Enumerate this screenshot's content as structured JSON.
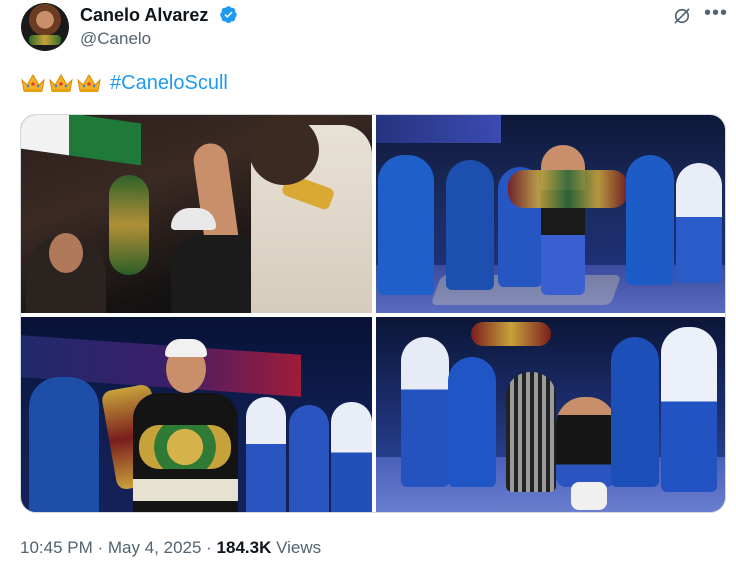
{
  "author": {
    "display_name": "Canelo Alvarez",
    "handle": "@Canelo",
    "verified": true,
    "avatar_icon": "profile-photo"
  },
  "actions": {
    "grok_icon": "grok-icon",
    "more_label": "•••"
  },
  "tweet": {
    "emojis": [
      "crown",
      "crown",
      "crown"
    ],
    "hashtag": "#CaneloScull"
  },
  "media": {
    "photo_count": 4
  },
  "meta": {
    "time": "10:45 PM",
    "sep1": " · ",
    "date": "May 4, 2025",
    "sep2": " · ",
    "views_count": "184.3K",
    "views_label": " Views"
  },
  "colors": {
    "link": "#1d9bf0",
    "secondary_text": "#536471",
    "primary_text": "#0f1419",
    "verified_badge": "#1d9bf0"
  }
}
